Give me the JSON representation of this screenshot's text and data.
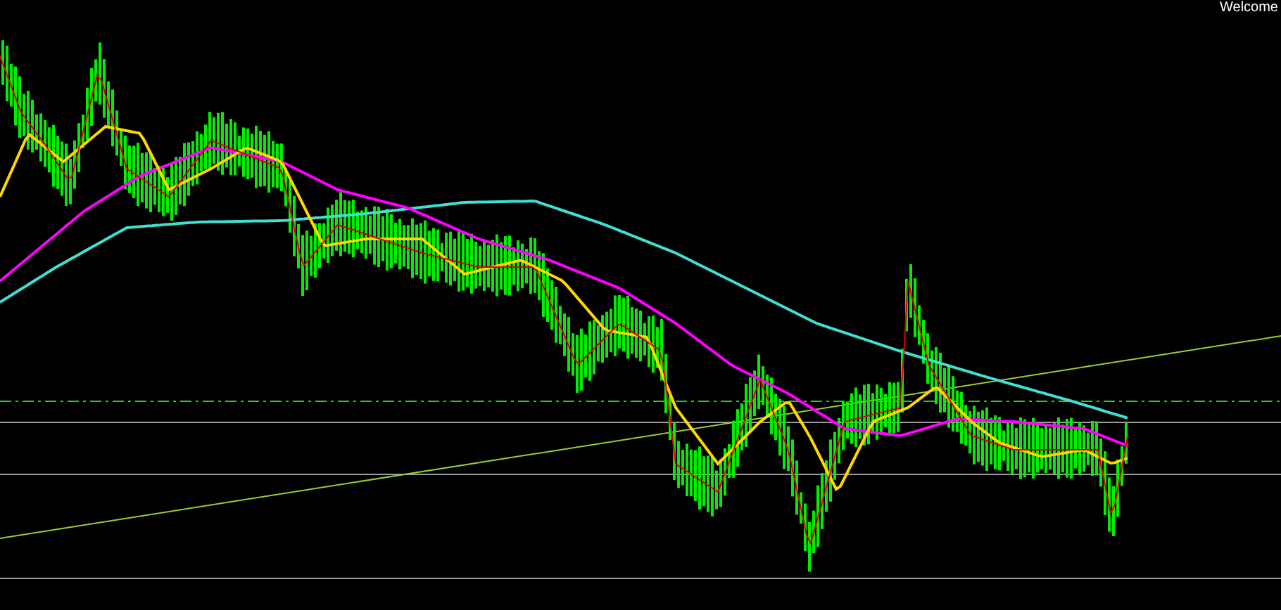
{
  "header": {
    "text": "Welcome"
  }
}
